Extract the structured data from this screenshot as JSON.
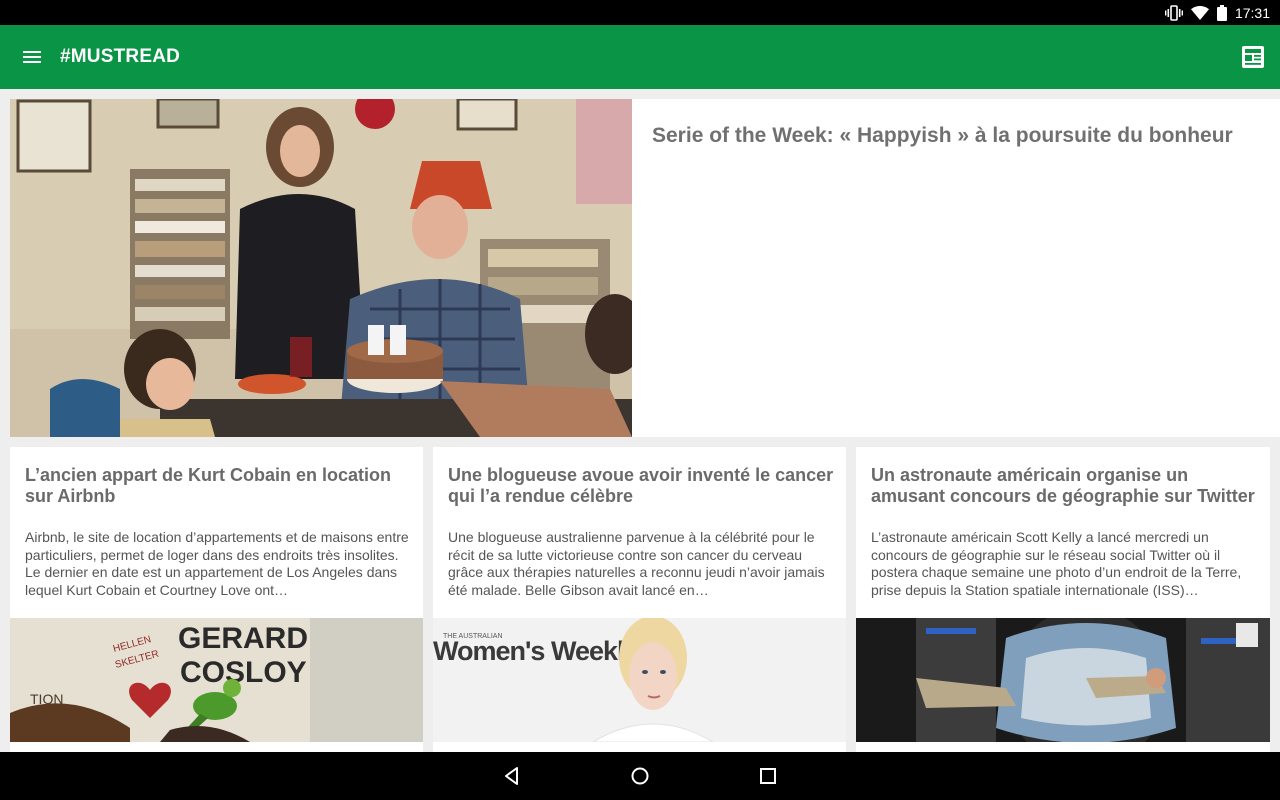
{
  "status_bar": {
    "time": "17:31",
    "icons": [
      "vibrate-icon",
      "wifi-icon",
      "battery-icon"
    ]
  },
  "app_bar": {
    "title": "#MUSTREAD",
    "menu_icon": "hamburger-menu-icon",
    "action_icon": "newspaper-icon",
    "color": "#0a9446"
  },
  "featured": {
    "title": "Serie of the Week: « Happyish » à la poursuite du bonheur",
    "image": "photo of a family at a kitchen table with a birthday cake with 44 candles"
  },
  "articles": [
    {
      "title": "L’ancien appart de Kurt Cobain en location sur Airbnb",
      "excerpt": "Airbnb, le site de location d’appartements et de maisons entre particuliers, permet de loger dans des endroits très insolites. Le dernier en date est un appartement de Los Angeles dans lequel Kurt Cobain et Courtney Love ont…",
      "image_text_1": "GERARD",
      "image_text_2": "COSLOY",
      "image_text_3": "HELLEN",
      "image_text_4": "SKELTER"
    },
    {
      "title": "Une blogueuse avoue avoir inventé le cancer qui l’a rendue célèbre",
      "excerpt": "Une blogueuse australienne parvenue à la célébrité pour le récit de sa lutte victorieuse contre son cancer du cerveau grâce aux thérapies naturelles a reconnu jeudi n’avoir jamais été malade. Belle Gibson avait lancé en…",
      "image_text_small": "THE AUSTRALIAN",
      "image_text_big": "Women's Weekly"
    },
    {
      "title": "Un astronaute américain organise un amusant concours de géographie sur Twitter",
      "excerpt": "L’astronaute américain Scott Kelly a lancé mercredi un concours de géographie sur le réseau social Twitter où il postera chaque semaine une photo d’un endroit de la Terre, prise depuis la Station spatiale internationale (ISS)…"
    }
  ],
  "nav_bar": {
    "icons": [
      "back-icon",
      "home-icon",
      "recents-icon"
    ]
  }
}
